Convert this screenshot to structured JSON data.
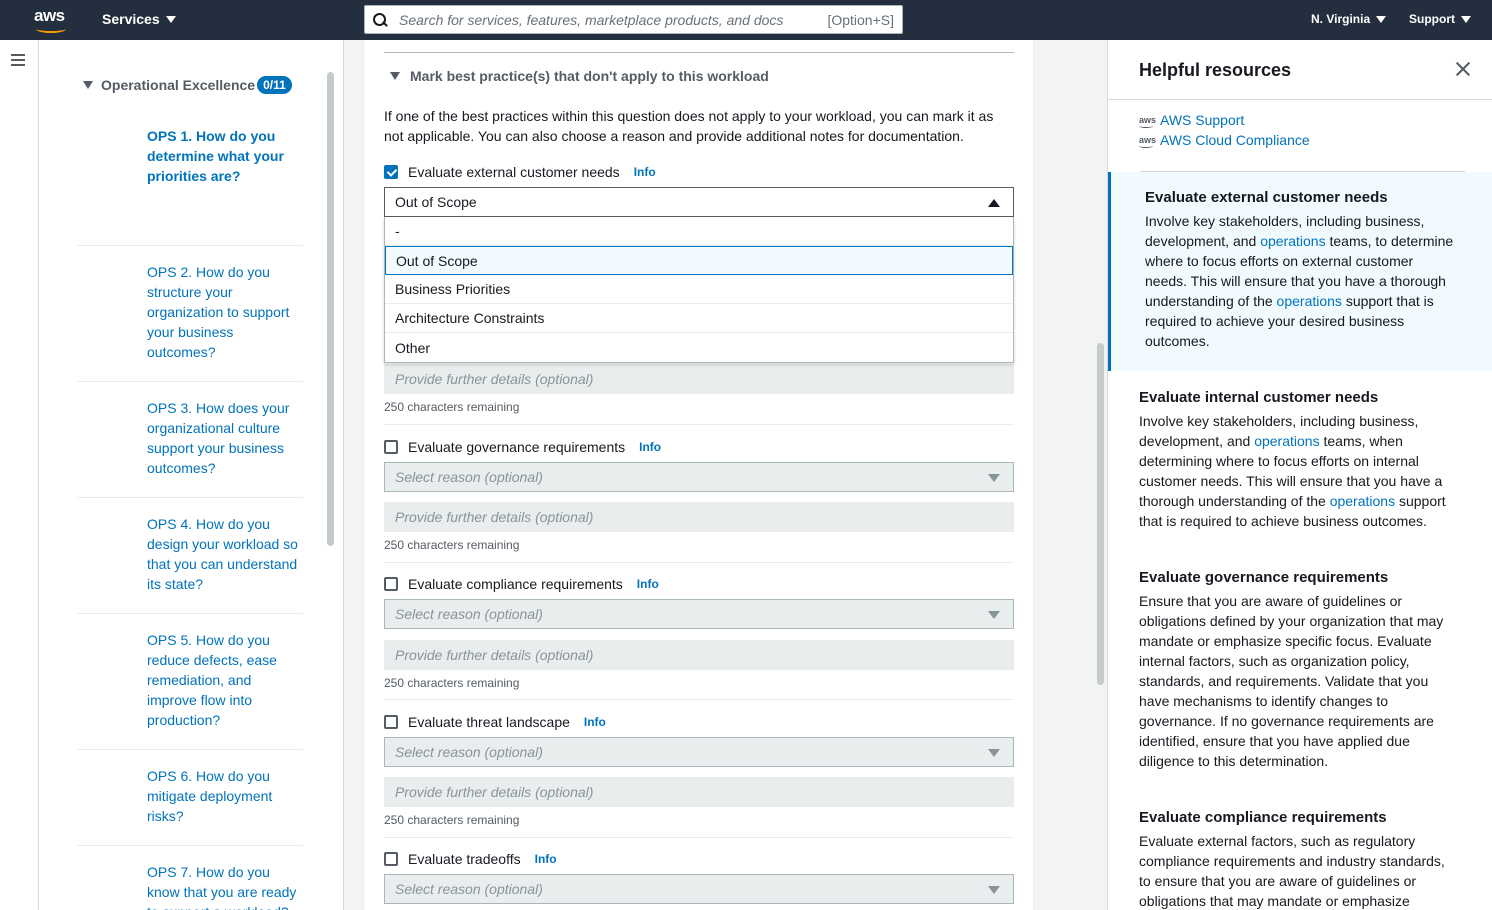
{
  "nav": {
    "logo": "aws",
    "services": "Services",
    "search_placeholder": "Search for services, features, marketplace products, and docs",
    "search_shortcut": "[Option+S]",
    "region": "N. Virginia",
    "support": "Support"
  },
  "left": {
    "pillar": "Operational Excellence",
    "badge": "0/11",
    "questions": [
      {
        "lines": [
          "OPS 1. How do you",
          "determine what your",
          "priorities are?"
        ]
      },
      {
        "lines": [
          "OPS 2. How do you",
          "structure your",
          "organization to support",
          "your business",
          "outcomes?"
        ]
      },
      {
        "lines": [
          "OPS 3. How does your",
          "organizational culture",
          "support your business",
          "outcomes?"
        ]
      },
      {
        "lines": [
          "OPS 4. How do you",
          "design your workload so",
          "that you can understand",
          "its state?"
        ]
      },
      {
        "lines": [
          "OPS 5. How do you",
          "reduce defects, ease",
          "remediation, and",
          "improve flow into",
          "production?"
        ]
      },
      {
        "lines": [
          "OPS 6. How do you",
          "mitigate deployment",
          "risks?"
        ]
      },
      {
        "lines": [
          "OPS 7. How do you",
          "know that you are ready",
          "to support a workload?"
        ]
      }
    ]
  },
  "main": {
    "section_title": "Mark best practice(s) that don't apply to this workload",
    "intro_line1": "If one of the best practices within this question does not apply to your workload, you can mark it as",
    "intro_line2": "not applicable. You can also choose a reason and provide additional notes for documentation.",
    "info": "Info",
    "reason_placeholder": "Select reason (optional)",
    "details_placeholder": "Provide further details (optional)",
    "remaining": "250 characters remaining",
    "practices": [
      {
        "label": "Evaluate external customer needs",
        "checked": true,
        "selected": "Out of Scope"
      },
      {
        "label": "Evaluate governance requirements",
        "checked": false
      },
      {
        "label": "Evaluate compliance requirements",
        "checked": false
      },
      {
        "label": "Evaluate threat landscape",
        "checked": false
      },
      {
        "label": "Evaluate tradeoffs",
        "checked": false
      }
    ],
    "dropdown_options": [
      "-",
      "Out of Scope",
      "Business Priorities",
      "Architecture Constraints",
      "Other"
    ]
  },
  "help": {
    "title": "Helpful resources",
    "mini_logo": "aws",
    "links": [
      "AWS Support",
      "AWS Cloud Compliance"
    ],
    "link_word": "operations",
    "sections": [
      {
        "title": "Evaluate external customer needs",
        "l1": "Involve key stakeholders, including business,",
        "l2a": "development, and ",
        "l2b": " teams, to determine",
        "l3": "where to focus efforts on external customer",
        "l4": "needs. This will ensure that you have a thorough",
        "l5a": "understanding of the ",
        "l5b": " support that is",
        "l6": "required to achieve your desired business",
        "l7": "outcomes."
      },
      {
        "title": "Evaluate internal customer needs",
        "l1": "Involve key stakeholders, including business,",
        "l2a": "development, and ",
        "l2b": " teams, when",
        "l3": "determining where to focus efforts on internal",
        "l4": "customer needs. This will ensure that you have a",
        "l5a": "thorough understanding of the ",
        "l5b": " support",
        "l6": "that is required to achieve business outcomes."
      },
      {
        "title": "Evaluate governance requirements",
        "lines": [
          "Ensure that you are aware of guidelines or",
          "obligations defined by your organization that may",
          "mandate or emphasize specific focus. Evaluate",
          "internal factors, such as organization policy,",
          "standards, and requirements. Validate that you",
          "have mechanisms to identify changes to",
          "governance. If no governance requirements are",
          "identified, ensure that you have applied due",
          "diligence to this determination."
        ]
      },
      {
        "title": "Evaluate compliance requirements",
        "lines": [
          "Evaluate external factors, such as regulatory",
          "compliance requirements and industry standards,",
          "to ensure that you are aware of guidelines or",
          "obligations that may mandate or emphasize"
        ]
      }
    ]
  }
}
